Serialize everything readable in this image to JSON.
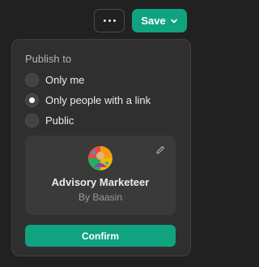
{
  "header": {
    "more_icon": "ellipsis-icon",
    "save_label": "Save",
    "save_icon": "chevron-down-icon",
    "accent": "#10a37f"
  },
  "publish": {
    "heading": "Publish to",
    "options": [
      {
        "label": "Only me",
        "selected": false
      },
      {
        "label": "Only people with a link",
        "selected": true
      },
      {
        "label": "Public",
        "selected": false
      }
    ]
  },
  "gpt": {
    "name": "Advisory Marketeer",
    "author": "By Baasin",
    "edit_icon": "pencil-icon"
  },
  "confirm_label": "Confirm"
}
